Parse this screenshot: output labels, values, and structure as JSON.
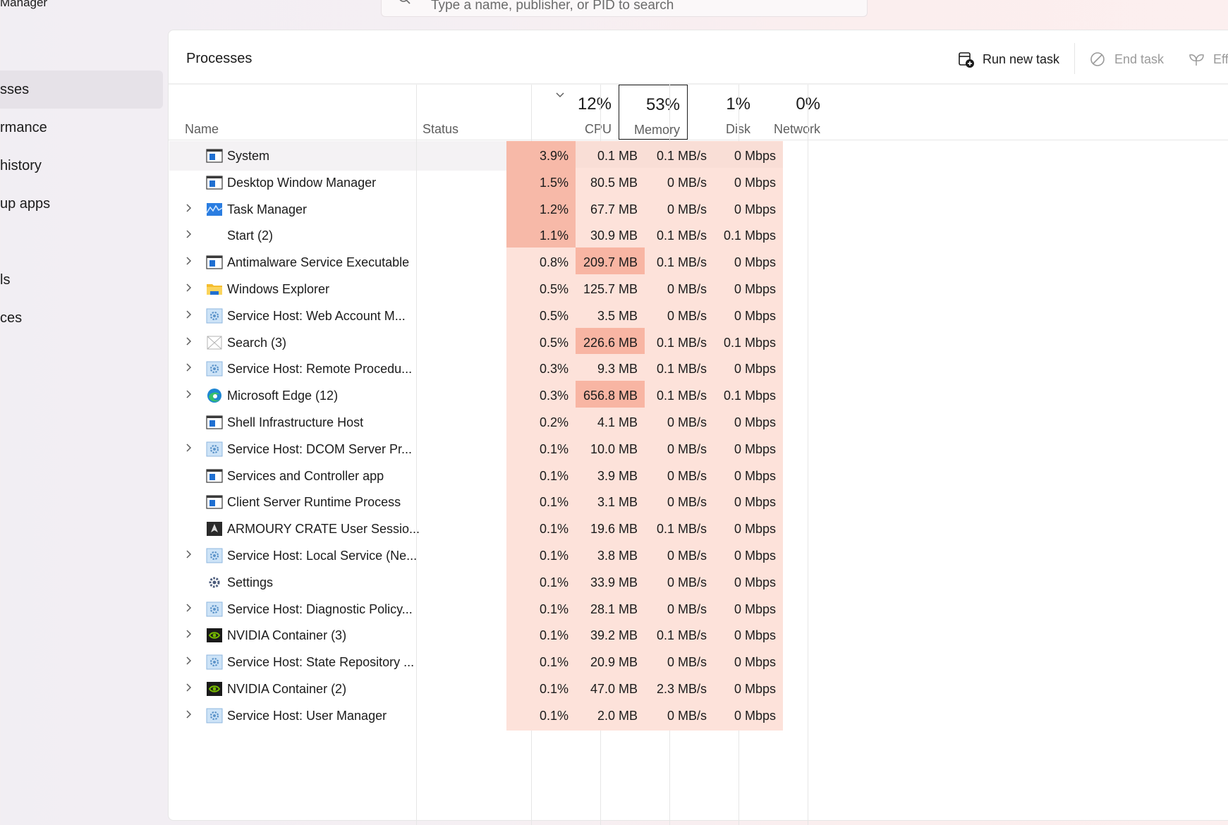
{
  "app": {
    "title": "Manager"
  },
  "search": {
    "placeholder": "Type a name, publisher, or PID to search"
  },
  "nav": [
    {
      "label": "sses",
      "active": true
    },
    {
      "label": "rmance",
      "active": false
    },
    {
      "label": "history",
      "active": false
    },
    {
      "label": "up apps",
      "active": false
    },
    {
      "label": "ls",
      "active": false
    },
    {
      "label": "ces",
      "active": false
    }
  ],
  "panel": {
    "title": "Processes"
  },
  "toolbar": {
    "run_new_task": "Run new task",
    "end_task": "End task",
    "efficiency": "Eff"
  },
  "columns": {
    "name": "Name",
    "status": "Status",
    "cpu": {
      "pct": "12%",
      "label": "CPU"
    },
    "memory": {
      "pct": "53%",
      "label": "Memory"
    },
    "disk": {
      "pct": "1%",
      "label": "Disk"
    },
    "network": {
      "pct": "0%",
      "label": "Network"
    }
  },
  "colors": {
    "heat_high": "#f7b9a8",
    "heat_mid": "#f9cdc1",
    "heat_low": "#fde2da",
    "heat_mem_high": "#f8b5a3",
    "accent_leaf": "#2e8b3a"
  },
  "rows": [
    {
      "name": "System",
      "expandable": false,
      "icon": "window-icon",
      "selected": true,
      "eco": false,
      "cpu": "3.9%",
      "mem": "0.1 MB",
      "disk": "0.1 MB/s",
      "net": "0 Mbps",
      "cpu_heat": "high",
      "mem_heat": "low",
      "disk_heat": "low",
      "net_heat": "low"
    },
    {
      "name": "Desktop Window Manager",
      "expandable": false,
      "icon": "window-icon",
      "selected": false,
      "eco": false,
      "cpu": "1.5%",
      "mem": "80.5 MB",
      "disk": "0 MB/s",
      "net": "0 Mbps",
      "cpu_heat": "high",
      "mem_heat": "low",
      "disk_heat": "low",
      "net_heat": "low"
    },
    {
      "name": "Task Manager",
      "expandable": true,
      "icon": "task-manager-icon",
      "selected": false,
      "eco": false,
      "cpu": "1.2%",
      "mem": "67.7 MB",
      "disk": "0 MB/s",
      "net": "0 Mbps",
      "cpu_heat": "high",
      "mem_heat": "low",
      "disk_heat": "low",
      "net_heat": "low"
    },
    {
      "name": "Start (2)",
      "expandable": true,
      "icon": "",
      "selected": false,
      "eco": false,
      "cpu": "1.1%",
      "mem": "30.9 MB",
      "disk": "0.1 MB/s",
      "net": "0.1 Mbps",
      "cpu_heat": "high",
      "mem_heat": "low",
      "disk_heat": "low",
      "net_heat": "low"
    },
    {
      "name": "Antimalware Service Executable",
      "expandable": true,
      "icon": "window-icon",
      "selected": false,
      "eco": false,
      "cpu": "0.8%",
      "mem": "209.7 MB",
      "disk": "0.1 MB/s",
      "net": "0 Mbps",
      "cpu_heat": "low",
      "mem_heat": "high",
      "disk_heat": "low",
      "net_heat": "low"
    },
    {
      "name": "Windows Explorer",
      "expandable": true,
      "icon": "folder-icon",
      "selected": false,
      "eco": false,
      "cpu": "0.5%",
      "mem": "125.7 MB",
      "disk": "0 MB/s",
      "net": "0 Mbps",
      "cpu_heat": "low",
      "mem_heat": "low",
      "disk_heat": "low",
      "net_heat": "low"
    },
    {
      "name": "Service Host: Web Account M...",
      "expandable": true,
      "icon": "gear-icon",
      "selected": false,
      "eco": false,
      "cpu": "0.5%",
      "mem": "3.5 MB",
      "disk": "0 MB/s",
      "net": "0 Mbps",
      "cpu_heat": "low",
      "mem_heat": "low",
      "disk_heat": "low",
      "net_heat": "low"
    },
    {
      "name": "Search (3)",
      "expandable": true,
      "icon": "placeholder-icon",
      "selected": false,
      "eco": false,
      "cpu": "0.5%",
      "mem": "226.6 MB",
      "disk": "0.1 MB/s",
      "net": "0.1 Mbps",
      "cpu_heat": "low",
      "mem_heat": "high",
      "disk_heat": "low",
      "net_heat": "low"
    },
    {
      "name": "Service Host: Remote Procedu...",
      "expandable": true,
      "icon": "gear-icon",
      "selected": false,
      "eco": false,
      "cpu": "0.3%",
      "mem": "9.3 MB",
      "disk": "0.1 MB/s",
      "net": "0 Mbps",
      "cpu_heat": "low",
      "mem_heat": "low",
      "disk_heat": "low",
      "net_heat": "low"
    },
    {
      "name": "Microsoft Edge (12)",
      "expandable": true,
      "icon": "edge-icon",
      "selected": false,
      "eco": true,
      "cpu": "0.3%",
      "mem": "656.8 MB",
      "disk": "0.1 MB/s",
      "net": "0.1 Mbps",
      "cpu_heat": "low",
      "mem_heat": "high",
      "disk_heat": "low",
      "net_heat": "low"
    },
    {
      "name": "Shell Infrastructure Host",
      "expandable": false,
      "icon": "window-icon",
      "selected": false,
      "eco": false,
      "cpu": "0.2%",
      "mem": "4.1 MB",
      "disk": "0 MB/s",
      "net": "0 Mbps",
      "cpu_heat": "low",
      "mem_heat": "low",
      "disk_heat": "low",
      "net_heat": "low"
    },
    {
      "name": "Service Host: DCOM Server Pr...",
      "expandable": true,
      "icon": "gear-icon",
      "selected": false,
      "eco": false,
      "cpu": "0.1%",
      "mem": "10.0 MB",
      "disk": "0 MB/s",
      "net": "0 Mbps",
      "cpu_heat": "low",
      "mem_heat": "low",
      "disk_heat": "low",
      "net_heat": "low"
    },
    {
      "name": "Services and Controller app",
      "expandable": false,
      "icon": "window-icon",
      "selected": false,
      "eco": false,
      "cpu": "0.1%",
      "mem": "3.9 MB",
      "disk": "0 MB/s",
      "net": "0 Mbps",
      "cpu_heat": "low",
      "mem_heat": "low",
      "disk_heat": "low",
      "net_heat": "low"
    },
    {
      "name": "Client Server Runtime Process",
      "expandable": false,
      "icon": "window-icon",
      "selected": false,
      "eco": false,
      "cpu": "0.1%",
      "mem": "3.1 MB",
      "disk": "0 MB/s",
      "net": "0 Mbps",
      "cpu_heat": "low",
      "mem_heat": "low",
      "disk_heat": "low",
      "net_heat": "low"
    },
    {
      "name": "ARMOURY CRATE User Sessio...",
      "expandable": false,
      "icon": "armoury-icon",
      "selected": false,
      "eco": false,
      "cpu": "0.1%",
      "mem": "19.6 MB",
      "disk": "0.1 MB/s",
      "net": "0 Mbps",
      "cpu_heat": "low",
      "mem_heat": "low",
      "disk_heat": "low",
      "net_heat": "low"
    },
    {
      "name": "Service Host: Local Service (Ne...",
      "expandable": true,
      "icon": "gear-icon",
      "selected": false,
      "eco": false,
      "cpu": "0.1%",
      "mem": "3.8 MB",
      "disk": "0 MB/s",
      "net": "0 Mbps",
      "cpu_heat": "low",
      "mem_heat": "low",
      "disk_heat": "low",
      "net_heat": "low"
    },
    {
      "name": "Settings",
      "expandable": false,
      "icon": "settings-icon",
      "selected": false,
      "eco": false,
      "cpu": "0.1%",
      "mem": "33.9 MB",
      "disk": "0 MB/s",
      "net": "0 Mbps",
      "cpu_heat": "low",
      "mem_heat": "low",
      "disk_heat": "low",
      "net_heat": "low"
    },
    {
      "name": "Service Host: Diagnostic Policy...",
      "expandable": true,
      "icon": "gear-icon",
      "selected": false,
      "eco": false,
      "cpu": "0.1%",
      "mem": "28.1 MB",
      "disk": "0 MB/s",
      "net": "0 Mbps",
      "cpu_heat": "low",
      "mem_heat": "low",
      "disk_heat": "low",
      "net_heat": "low"
    },
    {
      "name": "NVIDIA Container (3)",
      "expandable": true,
      "icon": "nvidia-icon",
      "selected": false,
      "eco": false,
      "cpu": "0.1%",
      "mem": "39.2 MB",
      "disk": "0.1 MB/s",
      "net": "0 Mbps",
      "cpu_heat": "low",
      "mem_heat": "low",
      "disk_heat": "low",
      "net_heat": "low"
    },
    {
      "name": "Service Host: State Repository ...",
      "expandable": true,
      "icon": "gear-icon",
      "selected": false,
      "eco": false,
      "cpu": "0.1%",
      "mem": "20.9 MB",
      "disk": "0 MB/s",
      "net": "0 Mbps",
      "cpu_heat": "low",
      "mem_heat": "low",
      "disk_heat": "low",
      "net_heat": "low"
    },
    {
      "name": "NVIDIA Container (2)",
      "expandable": true,
      "icon": "nvidia-icon",
      "selected": false,
      "eco": false,
      "cpu": "0.1%",
      "mem": "47.0 MB",
      "disk": "2.3 MB/s",
      "net": "0 Mbps",
      "cpu_heat": "low",
      "mem_heat": "low",
      "disk_heat": "low",
      "net_heat": "low"
    },
    {
      "name": "Service Host: User Manager",
      "expandable": true,
      "icon": "gear-icon",
      "selected": false,
      "eco": false,
      "cpu": "0.1%",
      "mem": "2.0 MB",
      "disk": "0 MB/s",
      "net": "0 Mbps",
      "cpu_heat": "low",
      "mem_heat": "low",
      "disk_heat": "low",
      "net_heat": "low"
    }
  ]
}
